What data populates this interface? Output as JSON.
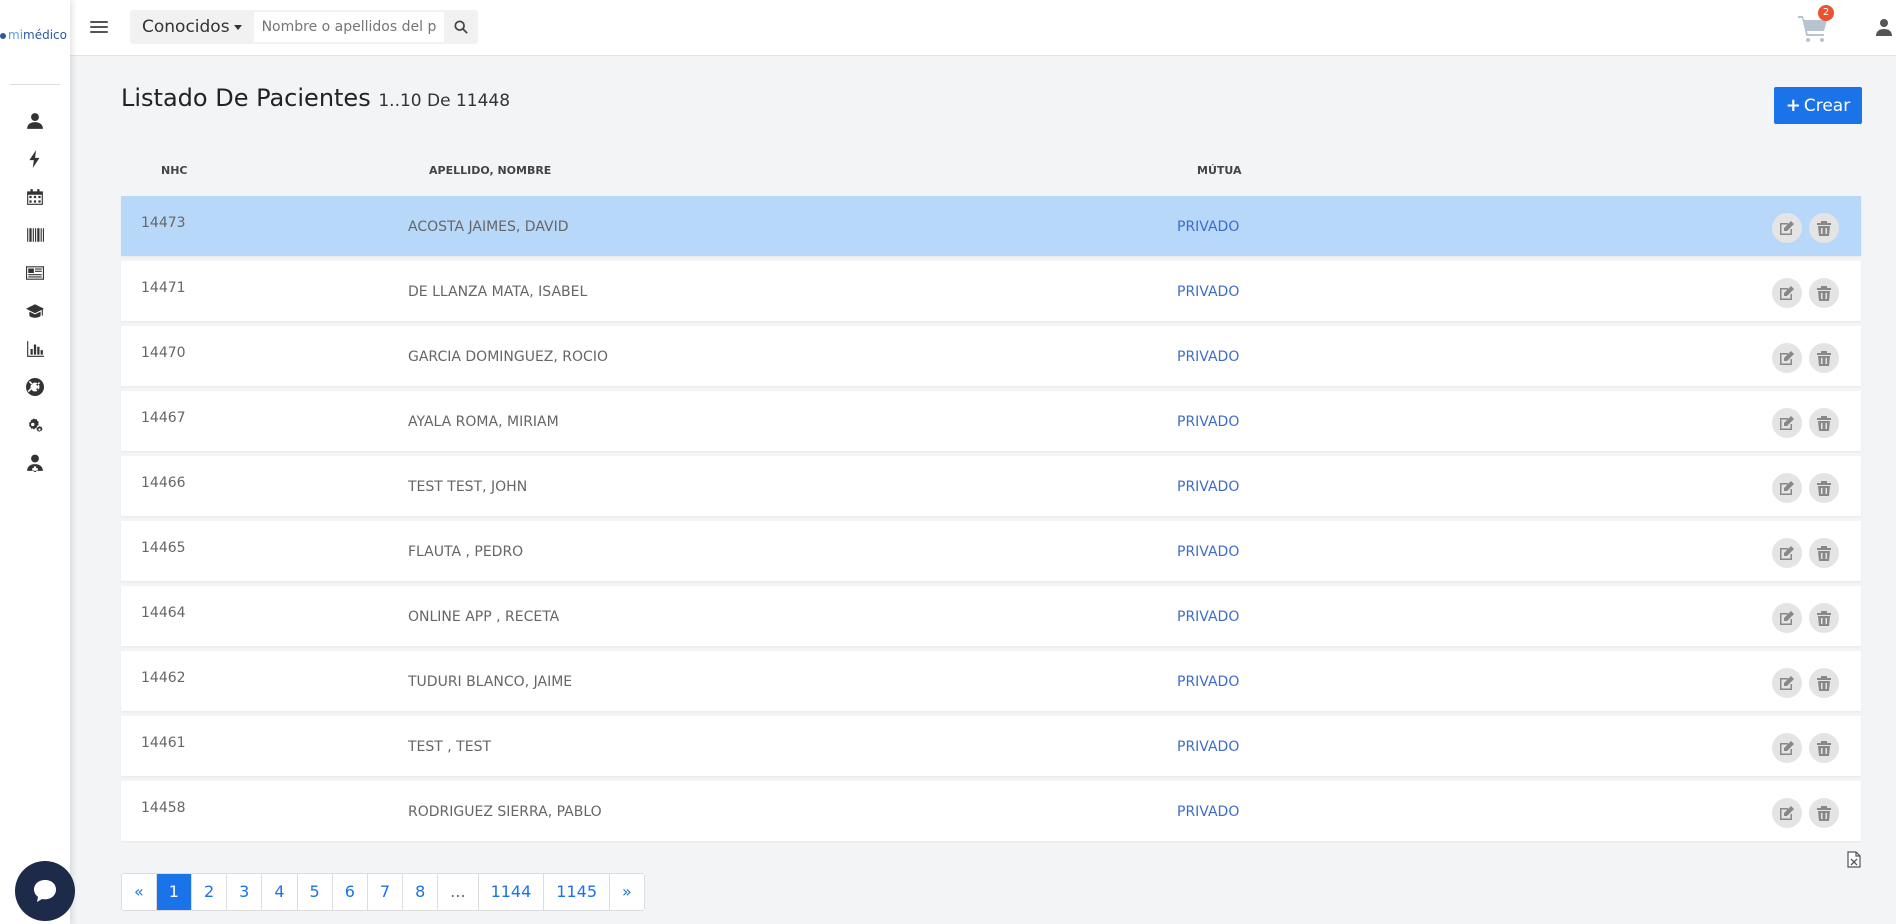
{
  "brand": {
    "prefix": "mi",
    "name": "médico"
  },
  "sidebar": {
    "items": [
      {
        "icon": "user-icon"
      },
      {
        "icon": "bolt-icon"
      },
      {
        "icon": "calendar-icon"
      },
      {
        "icon": "barcode-icon"
      },
      {
        "icon": "newspaper-icon"
      },
      {
        "icon": "graduation-cap-icon"
      },
      {
        "icon": "bar-chart-icon"
      },
      {
        "icon": "lifebuoy-icon"
      },
      {
        "icon": "gears-icon"
      },
      {
        "icon": "user-md-icon"
      }
    ]
  },
  "topbar": {
    "filter_label": "Conocidos",
    "search_placeholder": "Nombre o apellidos del paciente",
    "cart_count": "2"
  },
  "header": {
    "title": "Listado De Pacientes",
    "range": "1..10 De 11448",
    "create_label": "Crear"
  },
  "table": {
    "columns": {
      "nhc": "NHC",
      "name": "APELLIDO, NOMBRE",
      "mutua": "MÚTUA"
    },
    "rows": [
      {
        "nhc": "14473",
        "name": "ACOSTA JAIMES, DAVID",
        "mutua": "PRIVADO",
        "selected": true
      },
      {
        "nhc": "14471",
        "name": "DE LLANZA MATA, ISABEL",
        "mutua": "PRIVADO"
      },
      {
        "nhc": "14470",
        "name": "GARCIA DOMINGUEZ, ROCIO",
        "mutua": "PRIVADO"
      },
      {
        "nhc": "14467",
        "name": "AYALA ROMA, MIRIAM",
        "mutua": "PRIVADO"
      },
      {
        "nhc": "14466",
        "name": "TEST TEST, JOHN",
        "mutua": "PRIVADO"
      },
      {
        "nhc": "14465",
        "name": "FLAUTA , PEDRO",
        "mutua": "PRIVADO"
      },
      {
        "nhc": "14464",
        "name": "ONLINE APP , RECETA",
        "mutua": "PRIVADO"
      },
      {
        "nhc": "14462",
        "name": "TUDURI BLANCO, JAIME",
        "mutua": "PRIVADO"
      },
      {
        "nhc": "14461",
        "name": "TEST , TEST",
        "mutua": "PRIVADO"
      },
      {
        "nhc": "14458",
        "name": "RODRIGUEZ SIERRA, PABLO",
        "mutua": "PRIVADO"
      }
    ]
  },
  "pagination": {
    "pages": [
      {
        "label": "«"
      },
      {
        "label": "1",
        "active": true
      },
      {
        "label": "2"
      },
      {
        "label": "3"
      },
      {
        "label": "4"
      },
      {
        "label": "5"
      },
      {
        "label": "6"
      },
      {
        "label": "7"
      },
      {
        "label": "8"
      },
      {
        "label": "...",
        "muted": true
      },
      {
        "label": "1144"
      },
      {
        "label": "1145"
      },
      {
        "label": "»"
      }
    ]
  },
  "colors": {
    "accent": "#1a73e8",
    "selected_row": "#b8d8fa",
    "mutua_text": "#3d6cc9",
    "badge": "#e8542e"
  }
}
